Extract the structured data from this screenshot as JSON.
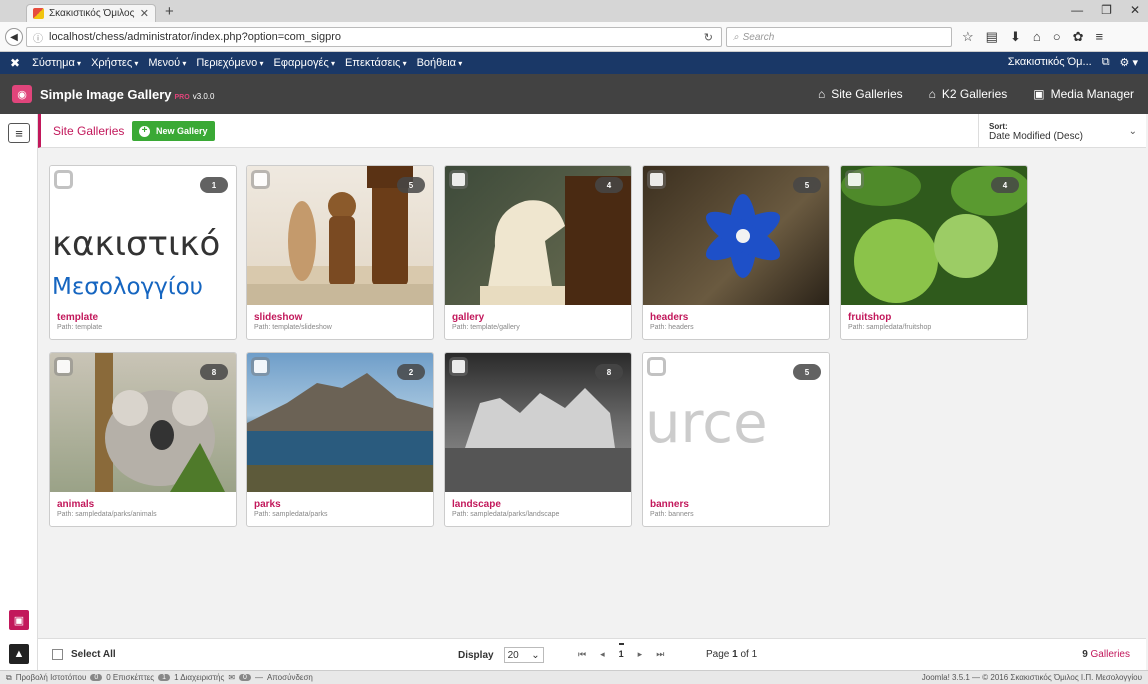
{
  "browser": {
    "tab_title": "Σκακιστικός Όμιλος Ι.Π. ...",
    "new_tab": "+",
    "url": "localhost/chess/administrator/index.php?option=com_sigpro",
    "search_placeholder": "Search"
  },
  "joomla_menu": {
    "items": [
      "Σύστημα",
      "Χρήστες",
      "Μενού",
      "Περιεχόμενο",
      "Εφαρμογές",
      "Επεκτάσεις",
      "Βοήθεια"
    ],
    "site_name": "Σκακιστικός Όμ..."
  },
  "sig": {
    "title": "Simple Image Gallery",
    "pro": "PRO",
    "version": "v3.0.0",
    "links": {
      "site_galleries": "Site Galleries",
      "k2_galleries": "K2 Galleries",
      "media_manager": "Media Manager"
    }
  },
  "header": {
    "title": "Site Galleries",
    "new_gallery": "New Gallery",
    "sort_label": "Sort:",
    "sort_value": "Date Modified (Desc)"
  },
  "galleries": [
    {
      "name": "template",
      "path": "Path: template",
      "count": "1",
      "thumb_text": "κακιστικό",
      "thumb_text2": "Μεσολογγίου"
    },
    {
      "name": "slideshow",
      "path": "Path: template/slideshow",
      "count": "5"
    },
    {
      "name": "gallery",
      "path": "Path: template/gallery",
      "count": "4"
    },
    {
      "name": "headers",
      "path": "Path: headers",
      "count": "5"
    },
    {
      "name": "fruitshop",
      "path": "Path: sampledata/fruitshop",
      "count": "4"
    },
    {
      "name": "animals",
      "path": "Path: sampledata/parks/animals",
      "count": "8"
    },
    {
      "name": "parks",
      "path": "Path: sampledata/parks",
      "count": "2"
    },
    {
      "name": "landscape",
      "path": "Path: sampledata/parks/landscape",
      "count": "8"
    },
    {
      "name": "banners",
      "path": "Path: banners",
      "count": "5",
      "thumb_text": "urce"
    }
  ],
  "footer": {
    "select_all": "Select All",
    "display_label": "Display",
    "display_value": "20",
    "page_prefix": "Page",
    "page_current": "1",
    "page_of": "of 1",
    "gallery_count": "9",
    "gallery_word": "Galleries"
  },
  "status": {
    "view_site": "Προβολή Ιστοτόπου",
    "visitors_count": "0",
    "visitors_label": "0 Επισκέπτες",
    "admins_count": "1",
    "admins_label": "1 Διαχειριστής",
    "messages_count": "0",
    "logout": "Αποσύνδεση",
    "copyright": "Joomla! 3.5.1 — © 2016 Σκακιστικός Όμιλος Ι.Π. Μεσολογγίου"
  },
  "colors": {
    "accent": "#c2185b",
    "joomla_blue": "#1a3867",
    "toolbar": "#424242",
    "green": "#3aa935"
  }
}
